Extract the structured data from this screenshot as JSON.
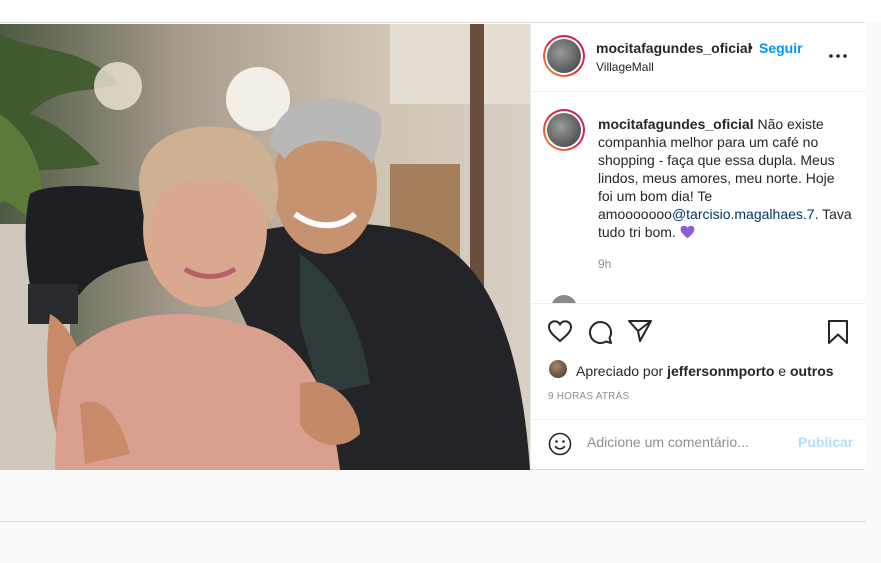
{
  "post": {
    "username": "mocitafagundes_oficial",
    "separator": "•",
    "follow_label": "Seguir",
    "location": "VillageMall",
    "more_icon": "more-horizontal-icon",
    "caption_user": "mocitafagundes_oficial",
    "caption_text": "Não existe companhia melhor para um café no shopping - faça que essa dupla. Meus lindos, meus amores, meu norte. Hoje foi um bom dia! Te amooooooo",
    "caption_mention": "@tarcisio.magalhaes.7",
    "caption_tail": ". Tava tudo tri bom.",
    "caption_emoji": "purple-heart-icon",
    "time": "9h",
    "liked_prefix": "Apreciado por",
    "liked_user": "jeffersonmporto",
    "liked_and": "e",
    "liked_others": "outros",
    "time_ago": "9 HORAS ATRÁS",
    "comment_placeholder": "Adicione um comentário...",
    "publish_label": "Publicar"
  },
  "colors": {
    "accent": "#0095f6",
    "publish_disabled": "#b2dffc",
    "muted": "#8e8e8e",
    "text": "#262626",
    "mention": "#00376b",
    "heart": "#8e5dd9"
  }
}
